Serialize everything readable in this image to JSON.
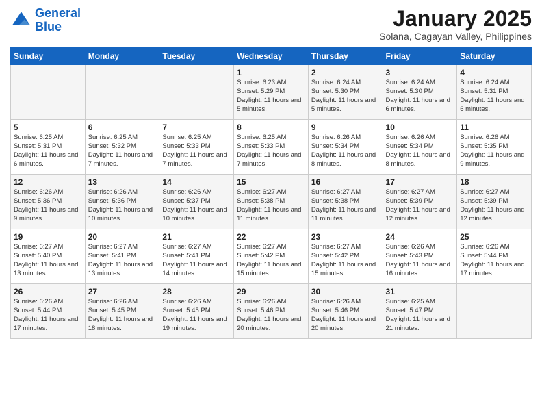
{
  "header": {
    "logo_general": "General",
    "logo_blue": "Blue",
    "month_title": "January 2025",
    "subtitle": "Solana, Cagayan Valley, Philippines"
  },
  "weekdays": [
    "Sunday",
    "Monday",
    "Tuesday",
    "Wednesday",
    "Thursday",
    "Friday",
    "Saturday"
  ],
  "weeks": [
    [
      {
        "day": "",
        "info": ""
      },
      {
        "day": "",
        "info": ""
      },
      {
        "day": "",
        "info": ""
      },
      {
        "day": "1",
        "info": "Sunrise: 6:23 AM\nSunset: 5:29 PM\nDaylight: 11 hours and 5 minutes."
      },
      {
        "day": "2",
        "info": "Sunrise: 6:24 AM\nSunset: 5:30 PM\nDaylight: 11 hours and 5 minutes."
      },
      {
        "day": "3",
        "info": "Sunrise: 6:24 AM\nSunset: 5:30 PM\nDaylight: 11 hours and 6 minutes."
      },
      {
        "day": "4",
        "info": "Sunrise: 6:24 AM\nSunset: 5:31 PM\nDaylight: 11 hours and 6 minutes."
      }
    ],
    [
      {
        "day": "5",
        "info": "Sunrise: 6:25 AM\nSunset: 5:31 PM\nDaylight: 11 hours and 6 minutes."
      },
      {
        "day": "6",
        "info": "Sunrise: 6:25 AM\nSunset: 5:32 PM\nDaylight: 11 hours and 7 minutes."
      },
      {
        "day": "7",
        "info": "Sunrise: 6:25 AM\nSunset: 5:33 PM\nDaylight: 11 hours and 7 minutes."
      },
      {
        "day": "8",
        "info": "Sunrise: 6:25 AM\nSunset: 5:33 PM\nDaylight: 11 hours and 7 minutes."
      },
      {
        "day": "9",
        "info": "Sunrise: 6:26 AM\nSunset: 5:34 PM\nDaylight: 11 hours and 8 minutes."
      },
      {
        "day": "10",
        "info": "Sunrise: 6:26 AM\nSunset: 5:34 PM\nDaylight: 11 hours and 8 minutes."
      },
      {
        "day": "11",
        "info": "Sunrise: 6:26 AM\nSunset: 5:35 PM\nDaylight: 11 hours and 9 minutes."
      }
    ],
    [
      {
        "day": "12",
        "info": "Sunrise: 6:26 AM\nSunset: 5:36 PM\nDaylight: 11 hours and 9 minutes."
      },
      {
        "day": "13",
        "info": "Sunrise: 6:26 AM\nSunset: 5:36 PM\nDaylight: 11 hours and 10 minutes."
      },
      {
        "day": "14",
        "info": "Sunrise: 6:26 AM\nSunset: 5:37 PM\nDaylight: 11 hours and 10 minutes."
      },
      {
        "day": "15",
        "info": "Sunrise: 6:27 AM\nSunset: 5:38 PM\nDaylight: 11 hours and 11 minutes."
      },
      {
        "day": "16",
        "info": "Sunrise: 6:27 AM\nSunset: 5:38 PM\nDaylight: 11 hours and 11 minutes."
      },
      {
        "day": "17",
        "info": "Sunrise: 6:27 AM\nSunset: 5:39 PM\nDaylight: 11 hours and 12 minutes."
      },
      {
        "day": "18",
        "info": "Sunrise: 6:27 AM\nSunset: 5:39 PM\nDaylight: 11 hours and 12 minutes."
      }
    ],
    [
      {
        "day": "19",
        "info": "Sunrise: 6:27 AM\nSunset: 5:40 PM\nDaylight: 11 hours and 13 minutes."
      },
      {
        "day": "20",
        "info": "Sunrise: 6:27 AM\nSunset: 5:41 PM\nDaylight: 11 hours and 13 minutes."
      },
      {
        "day": "21",
        "info": "Sunrise: 6:27 AM\nSunset: 5:41 PM\nDaylight: 11 hours and 14 minutes."
      },
      {
        "day": "22",
        "info": "Sunrise: 6:27 AM\nSunset: 5:42 PM\nDaylight: 11 hours and 15 minutes."
      },
      {
        "day": "23",
        "info": "Sunrise: 6:27 AM\nSunset: 5:42 PM\nDaylight: 11 hours and 15 minutes."
      },
      {
        "day": "24",
        "info": "Sunrise: 6:26 AM\nSunset: 5:43 PM\nDaylight: 11 hours and 16 minutes."
      },
      {
        "day": "25",
        "info": "Sunrise: 6:26 AM\nSunset: 5:44 PM\nDaylight: 11 hours and 17 minutes."
      }
    ],
    [
      {
        "day": "26",
        "info": "Sunrise: 6:26 AM\nSunset: 5:44 PM\nDaylight: 11 hours and 17 minutes."
      },
      {
        "day": "27",
        "info": "Sunrise: 6:26 AM\nSunset: 5:45 PM\nDaylight: 11 hours and 18 minutes."
      },
      {
        "day": "28",
        "info": "Sunrise: 6:26 AM\nSunset: 5:45 PM\nDaylight: 11 hours and 19 minutes."
      },
      {
        "day": "29",
        "info": "Sunrise: 6:26 AM\nSunset: 5:46 PM\nDaylight: 11 hours and 20 minutes."
      },
      {
        "day": "30",
        "info": "Sunrise: 6:26 AM\nSunset: 5:46 PM\nDaylight: 11 hours and 20 minutes."
      },
      {
        "day": "31",
        "info": "Sunrise: 6:25 AM\nSunset: 5:47 PM\nDaylight: 11 hours and 21 minutes."
      },
      {
        "day": "",
        "info": ""
      }
    ]
  ]
}
